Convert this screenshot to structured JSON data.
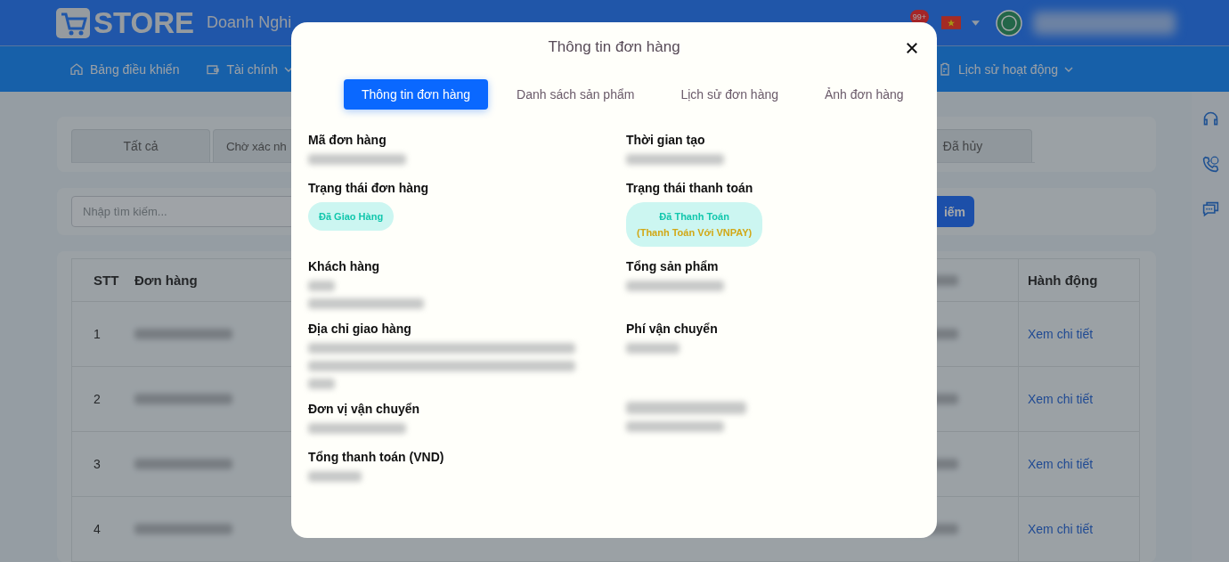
{
  "header": {
    "logo_text": "STORE",
    "company": "Doanh Nghi",
    "notification_count": "99+"
  },
  "nav": [
    {
      "label": "Bảng điều khiển",
      "dropdown": false
    },
    {
      "label": "Tài chính",
      "dropdown": true
    },
    {
      "label": "Lịch sử hoạt động",
      "dropdown": true
    }
  ],
  "status_tabs": [
    {
      "label": "Tất cả"
    },
    {
      "label": "Chờ xác nh"
    },
    {
      "label": "Đã hủy"
    }
  ],
  "search": {
    "placeholder": "Nhập tìm kiếm...",
    "button": "iếm"
  },
  "table": {
    "columns": [
      "STT",
      "Đơn hàng",
      "Hành động"
    ],
    "rows": [
      {
        "stt": "1",
        "action": "Xem chi tiết"
      },
      {
        "stt": "2",
        "action": "Xem chi tiết"
      },
      {
        "stt": "3",
        "action": "Xem chi tiết"
      },
      {
        "stt": "4",
        "action": "Xem chi tiết"
      }
    ]
  },
  "modal": {
    "title": "Thông tin đơn hàng",
    "tabs": [
      {
        "label": "Thông tin đơn hàng",
        "selected": true
      },
      {
        "label": "Danh sách sản phẩm",
        "selected": false
      },
      {
        "label": "Lịch sử đơn hàng",
        "selected": false
      },
      {
        "label": "Ảnh đơn hàng",
        "selected": false
      }
    ],
    "fields": [
      {
        "label": "Mã đơn hàng",
        "kind": "redacted"
      },
      {
        "label": "Thời gian tạo",
        "kind": "redacted"
      },
      {
        "label": "Trạng thái đơn hàng",
        "kind": "status",
        "status": "Đã Giao Hàng"
      },
      {
        "label": "Trạng thái thanh toán",
        "kind": "status",
        "status": "Đã Thanh Toán",
        "note": "(Thanh Toán Với VNPAY)"
      },
      {
        "label": "Khách hàng",
        "kind": "redacted_two_lines"
      },
      {
        "label": "Tổng sản phẩm",
        "kind": "redacted"
      },
      {
        "label": "Địa chỉ giao hàng",
        "kind": "redacted_address"
      },
      {
        "label": "Phí vận chuyển",
        "kind": "redacted_short"
      },
      {
        "label": "Đơn vị vận chuyển",
        "kind": "redacted"
      },
      {
        "kind": "redacted_field"
      },
      {
        "label": "Tổng thanh toán (VND)",
        "kind": "redacted_short"
      }
    ]
  }
}
